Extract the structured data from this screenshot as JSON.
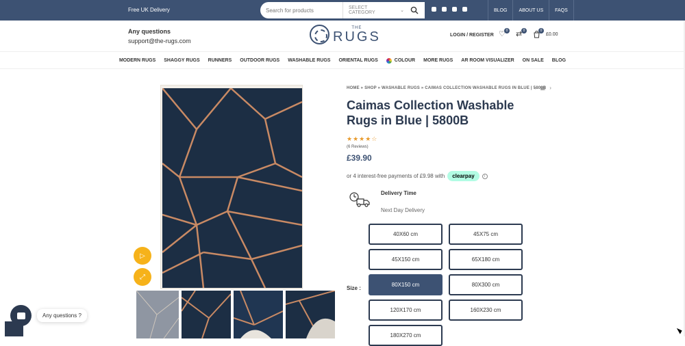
{
  "topbar": {
    "promo": "Free UK Delivery",
    "search_placeholder": "Search for products",
    "category_label": "SELECT CATEGORY",
    "links": [
      "BLOG",
      "ABOUT US",
      "FAQS"
    ]
  },
  "header": {
    "questions_title": "Any questions",
    "questions_email": "support@the-rugs.com",
    "logo_small": "THE",
    "logo_big": "RUGS",
    "account_label": "LOGIN / REGISTER",
    "wishlist_count": "0",
    "compare_count": "0",
    "cart_count": "0",
    "cart_total": "£0.00"
  },
  "nav": {
    "items": [
      "MODERN RUGS",
      "SHAGGY RUGS",
      "RUNNERS",
      "OUTDOOR RUGS",
      "WASHABLE RUGS",
      "ORIENTAL RUGS",
      "COLOUR",
      "MORE RUGS",
      "AR ROOM VISUALIZER",
      "ON SALE",
      "BLOG"
    ]
  },
  "product": {
    "breadcrumb": "HOME » SHOP » WASHABLE RUGS » CAIMAS COLLECTION WASHABLE RUGS IN BLUE | 5800B",
    "title": "Caimas Collection Washable Rugs in Blue | 5800B",
    "stars": "★★★★☆",
    "rating": 4.5,
    "reviews": "(6 Reviews)",
    "price": "£39.90",
    "clearpay_text": "or 4 interest-free payments of £9.98 with",
    "clearpay_badge": "clearpay",
    "delivery_title": "Delivery Time",
    "delivery_sub": "Next Day Delivery",
    "size_label": "Size :",
    "sizes": [
      "40X60 cm",
      "45X75 cm",
      "45X150 cm",
      "65X180 cm",
      "80X150 cm",
      "80X300 cm",
      "120X170 cm",
      "160X230 cm",
      "180X270 cm"
    ],
    "selected_size": "80X150 cm"
  },
  "chat": {
    "bubble": "Any questions ?"
  },
  "colors": {
    "brand": "#3d5273",
    "accent": "#f6b21a",
    "rug_navy": "#1c2e44",
    "rug_copper": "#c98a64"
  }
}
